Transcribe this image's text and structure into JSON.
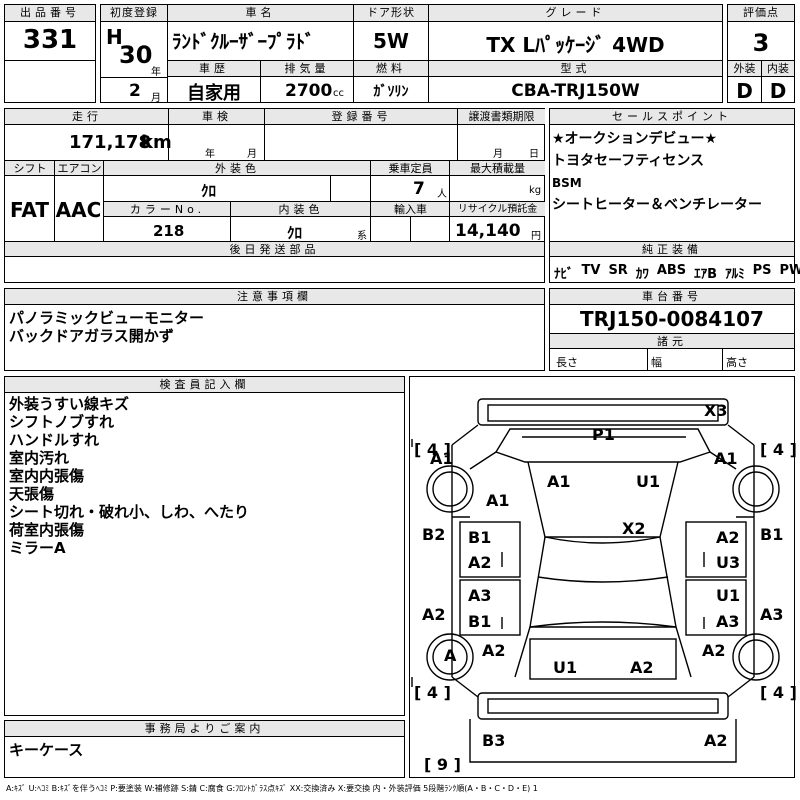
{
  "headers": {
    "lot_no": "出品番号",
    "first_reg": "初度登録",
    "car_name": "車名",
    "door": "ドア形状",
    "grade": "グレード",
    "score": "評価点",
    "history": "車歴",
    "displacement": "排気量",
    "fuel": "燃料",
    "model_code": "型式",
    "exterior": "外装",
    "interior": "内装",
    "mileage": "走行",
    "inspection": "車検",
    "reg_no": "登録番号",
    "transfer_deadline": "譲渡書類期限",
    "sales_point": "セールスポイント",
    "shift": "シフト",
    "aircon": "エアコン",
    "ext_color": "外装色",
    "capacity": "乗車定員",
    "max_load": "最大積載量",
    "color_no": "カラーNo.",
    "int_color": "内装色",
    "import": "輸入車",
    "recycle": "リサイクル預託金",
    "later_parts": "後日発送部品",
    "genuine_equipment": "純正装備",
    "caution": "注意事項欄",
    "chassis_no": "車台番号",
    "specs": "諸元",
    "inspector_notes": "検査員記入欄",
    "office_notes": "事務局よりご案内"
  },
  "lot_no": "331",
  "era": "H",
  "year": "30",
  "year_unit": "年",
  "month": "2",
  "month_unit": "月",
  "car_name": "ﾗﾝﾄﾞｸﾙｰｻﾞｰﾌﾟﾗﾄﾞ",
  "door_type": "5W",
  "grade": "TX Lﾊﾟｯｹｰｼﾞ 4WD",
  "score": "3",
  "history": "自家用",
  "displacement": "2700",
  "displacement_unit": "cc",
  "fuel": "ｶﾞｿﾘﾝ",
  "model_code": "CBA-TRJ150W",
  "exterior_grade": "D",
  "interior_grade": "D",
  "mileage": "171,178",
  "mileage_unit": "km",
  "inspection_year_unit": "年",
  "inspection_month_unit": "月",
  "transfer_month_unit": "月",
  "transfer_day_unit": "日",
  "shift": "FAT",
  "aircon": "AAC",
  "ext_color": "ｸﾛ",
  "capacity": "7",
  "capacity_unit": "人",
  "max_load_unit": "kg",
  "color_no": "218",
  "int_color": "ｸﾛ",
  "int_color_suffix": "系",
  "recycle": "14,140",
  "recycle_unit": "円",
  "sales_points": [
    "★オークションデビュー★",
    "トヨタセーフティセンス",
    "BSM",
    "シートヒーター＆ベンチレーター"
  ],
  "equipment": [
    "ﾅﾋﾞ",
    "TV",
    "SR",
    "ｶﾜ",
    "ABS",
    "ｴｱB",
    "ｱﾙﾐ",
    "PS",
    "PW"
  ],
  "caution_lines": [
    "パノラミックビューモニター",
    "バックドアガラス開かず"
  ],
  "chassis_no": "TRJ150-0084107",
  "spec_length": "長さ",
  "spec_width": "幅",
  "spec_height": "高さ",
  "inspector_lines": [
    "外装うすい線キズ",
    "シフトノブすれ",
    "ハンドルすれ",
    "室内汚れ",
    "室内内張傷",
    "天張傷",
    "シート切れ・破れ小、しわ、へたり",
    "荷室内張傷",
    "ミラーA"
  ],
  "office_lines": [
    "キーケース"
  ],
  "legend": "A:ｷｽﾞ U:ﾍｺﾐ B:ｷｽﾞを伴うﾍｺﾐ P:要塗装 W:補修跡 S:錆 C:腐食 G:ﾌﾛﾝﾄｶﾞﾗｽ点ｷｽﾞ XX:交換済み X:要交換 内・外装評価 5段階ﾗﾝｸ順(A・B・C・D・E) 1",
  "diagram": {
    "tire_fl": "4",
    "tire_fr": "4",
    "tire_rl": "4",
    "tire_rr": "4",
    "spare": "9",
    "labels": {
      "x3": "X3",
      "p1": "P1",
      "a1_fl": "A1",
      "a1_fr": "A1",
      "a1_hood_l": "A1",
      "u1_hood": "U1",
      "a1_fender_l": "A1",
      "x2": "X2",
      "b2_l": "B2",
      "b1_r": "B1",
      "b1_door_fl": "B1",
      "a2_door_fl": "A2",
      "a2_door_fr": "A2",
      "u3_door_fr": "U3",
      "a3_door_rl": "A3",
      "b1_door_rl": "B1",
      "u1_door_rr": "U1",
      "a3_door_rr": "A3",
      "a2_l": "A2",
      "a3_r": "A3",
      "a_wheel": "A",
      "a2_rear_l": "A2",
      "a2_rear_r": "A2",
      "u1_roof": "U1",
      "a2_roof": "A2",
      "b3": "B3",
      "a2_bumper": "A2"
    }
  }
}
